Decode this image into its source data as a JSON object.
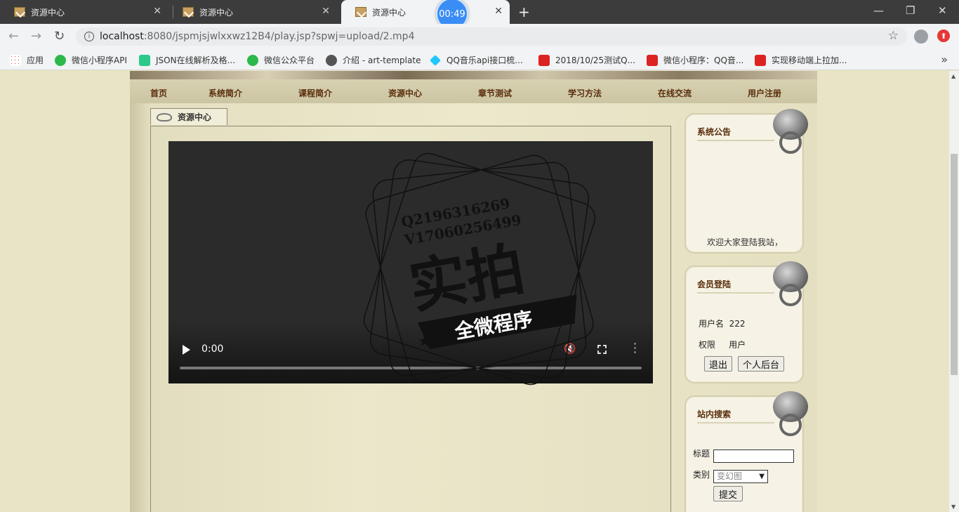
{
  "browser": {
    "tabs": [
      {
        "title": "资源中心"
      },
      {
        "title": "资源中心"
      },
      {
        "title": "资源中心"
      }
    ],
    "timer": "00:49",
    "url_host": "localhost",
    "url_path": ":8080/jspmjsjwlxxwz12B4/play.jsp?spwj=upload/2.mp4",
    "bookmarks": [
      "应用",
      "微信小程序API",
      "JSON在线解析及格...",
      "微信公众平台",
      "介绍 - art-template",
      "QQ音乐api接口梳...",
      "2018/10/25测试Q...",
      "微信小程序：QQ音...",
      "实现移动端上拉加..."
    ]
  },
  "site": {
    "nav": [
      "首页",
      "系统简介",
      "课程简介",
      "资源中心",
      "章节测试",
      "学习方法",
      "在线交流",
      "用户注册"
    ],
    "content_tab": "资源中心",
    "video": {
      "time": "0:00",
      "watermark_line1": "Q2196316269",
      "watermark_line2": "V17060256499",
      "watermark_big": "实拍",
      "watermark_ribbon": "全微程序"
    },
    "notice": {
      "title": "系统公告",
      "text": "欢迎大家登陆我站，"
    },
    "login": {
      "title": "会员登陆",
      "username_label": "用户名",
      "username_value": "222",
      "role_label": "权限",
      "role_value": "用户",
      "logout_label": "退出",
      "profile_label": "个人后台"
    },
    "search": {
      "title": "站内搜索",
      "title_label": "标题",
      "category_label": "类别",
      "category_value": "变幻图",
      "submit_label": "提交"
    }
  }
}
